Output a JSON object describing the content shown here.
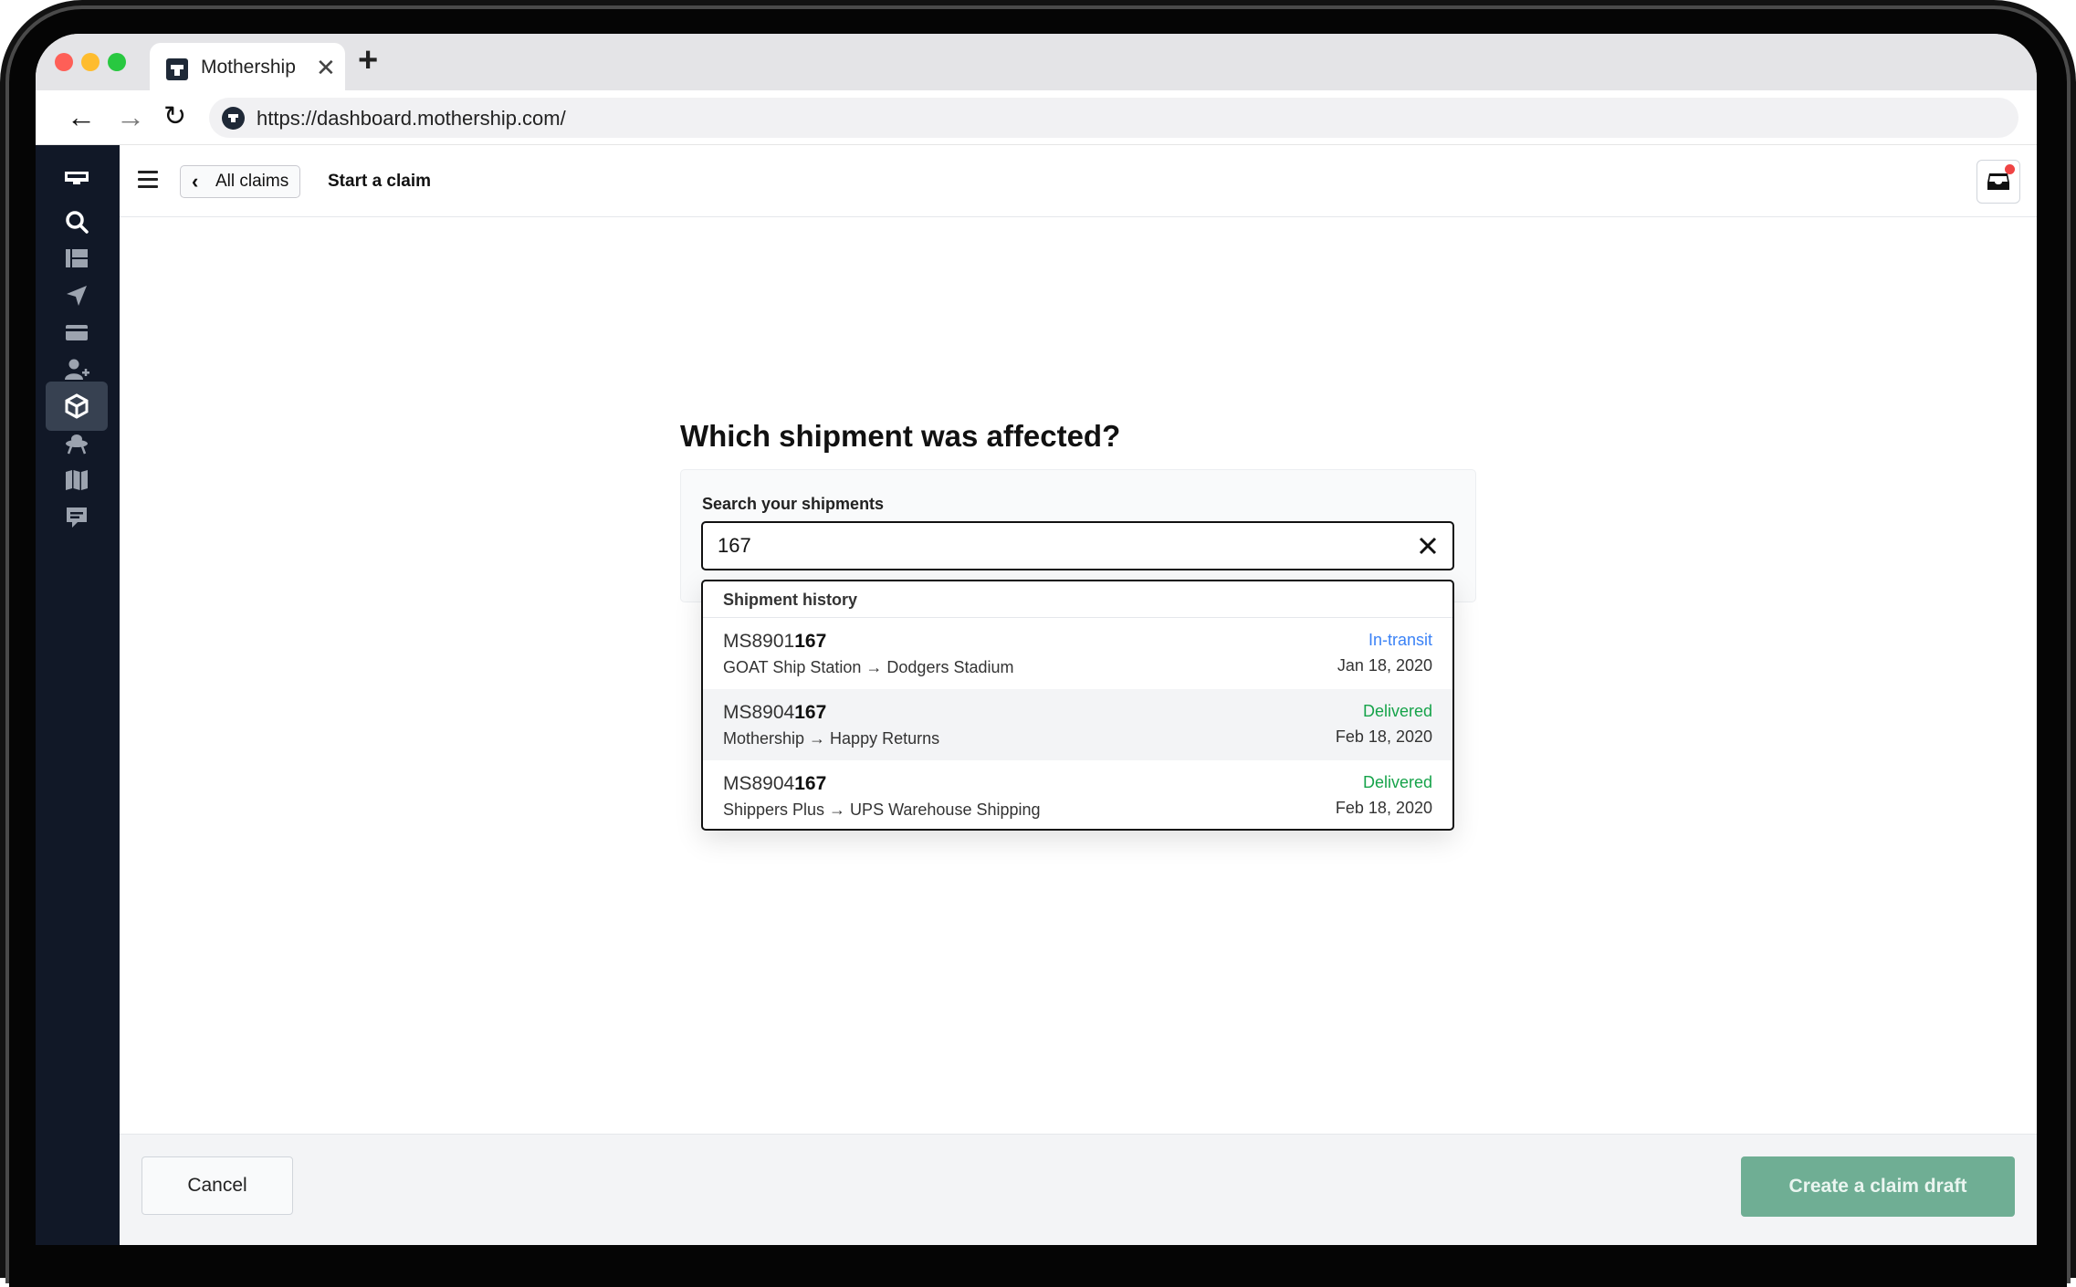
{
  "browser": {
    "tab_title": "Mothership",
    "url": "https://dashboard.mothership.com/"
  },
  "topbar": {
    "back_label": "All claims",
    "current": "Start a claim"
  },
  "sidebar": {
    "items": [
      {
        "icon": "logo-icon"
      },
      {
        "icon": "search-icon"
      },
      {
        "icon": "freight-icon"
      },
      {
        "icon": "send-icon"
      },
      {
        "icon": "billing-card-icon"
      },
      {
        "icon": "add-user-icon"
      },
      {
        "icon": "package-icon",
        "active": true
      },
      {
        "icon": "ufo-icon"
      },
      {
        "icon": "map-icon"
      },
      {
        "icon": "chat-icon"
      }
    ]
  },
  "main": {
    "question": "Which shipment was affected?",
    "search_label": "Search your shipments",
    "search_value": "167",
    "dropdown_header": "Shipment history",
    "results": [
      {
        "id_prefix": "MS8901",
        "id_match": "167",
        "route": "GOAT Ship Station → Dodgers Stadium",
        "status": "In-transit",
        "date": "Jan 18, 2020"
      },
      {
        "id_prefix": "MS8904",
        "id_match": "167",
        "route": "Mothership → Happy Returns",
        "status": "Delivered",
        "date": "Feb 18, 2020"
      },
      {
        "id_prefix": "MS8904",
        "id_match": "167",
        "route": "Shippers Plus → UPS Warehouse Shipping",
        "status": "Delivered",
        "date": "Feb 18, 2020"
      }
    ]
  },
  "footer": {
    "cancel_label": "Cancel",
    "create_label": "Create a claim draft"
  },
  "colors": {
    "sidebar": "#111827",
    "in_transit": "#3b82f6",
    "delivered": "#16a34a",
    "primary_button": "#6fae94"
  }
}
